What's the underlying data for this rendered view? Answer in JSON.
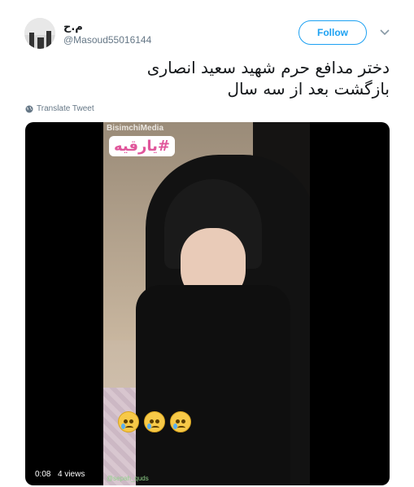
{
  "user": {
    "display_name": "م.ح",
    "handle": "@Masoud55016144"
  },
  "actions": {
    "follow_label": "Follow"
  },
  "tweet": {
    "line1": "دختر مدافع حرم شهید سعید انصاری",
    "line2": "بازگشت بعد از سه سال",
    "translate_label": "Translate Tweet"
  },
  "video": {
    "watermark": "BisimchiMedia",
    "hashtag": "#یارقیه",
    "bottom_tag": "@sepah_quds",
    "time": "0:08",
    "views": "4 views"
  },
  "colors": {
    "accent": "#1da1f2",
    "hashtag": "#e0569b"
  },
  "icons": [
    "chevron-down-icon",
    "globe-icon",
    "crying-face-icon"
  ]
}
